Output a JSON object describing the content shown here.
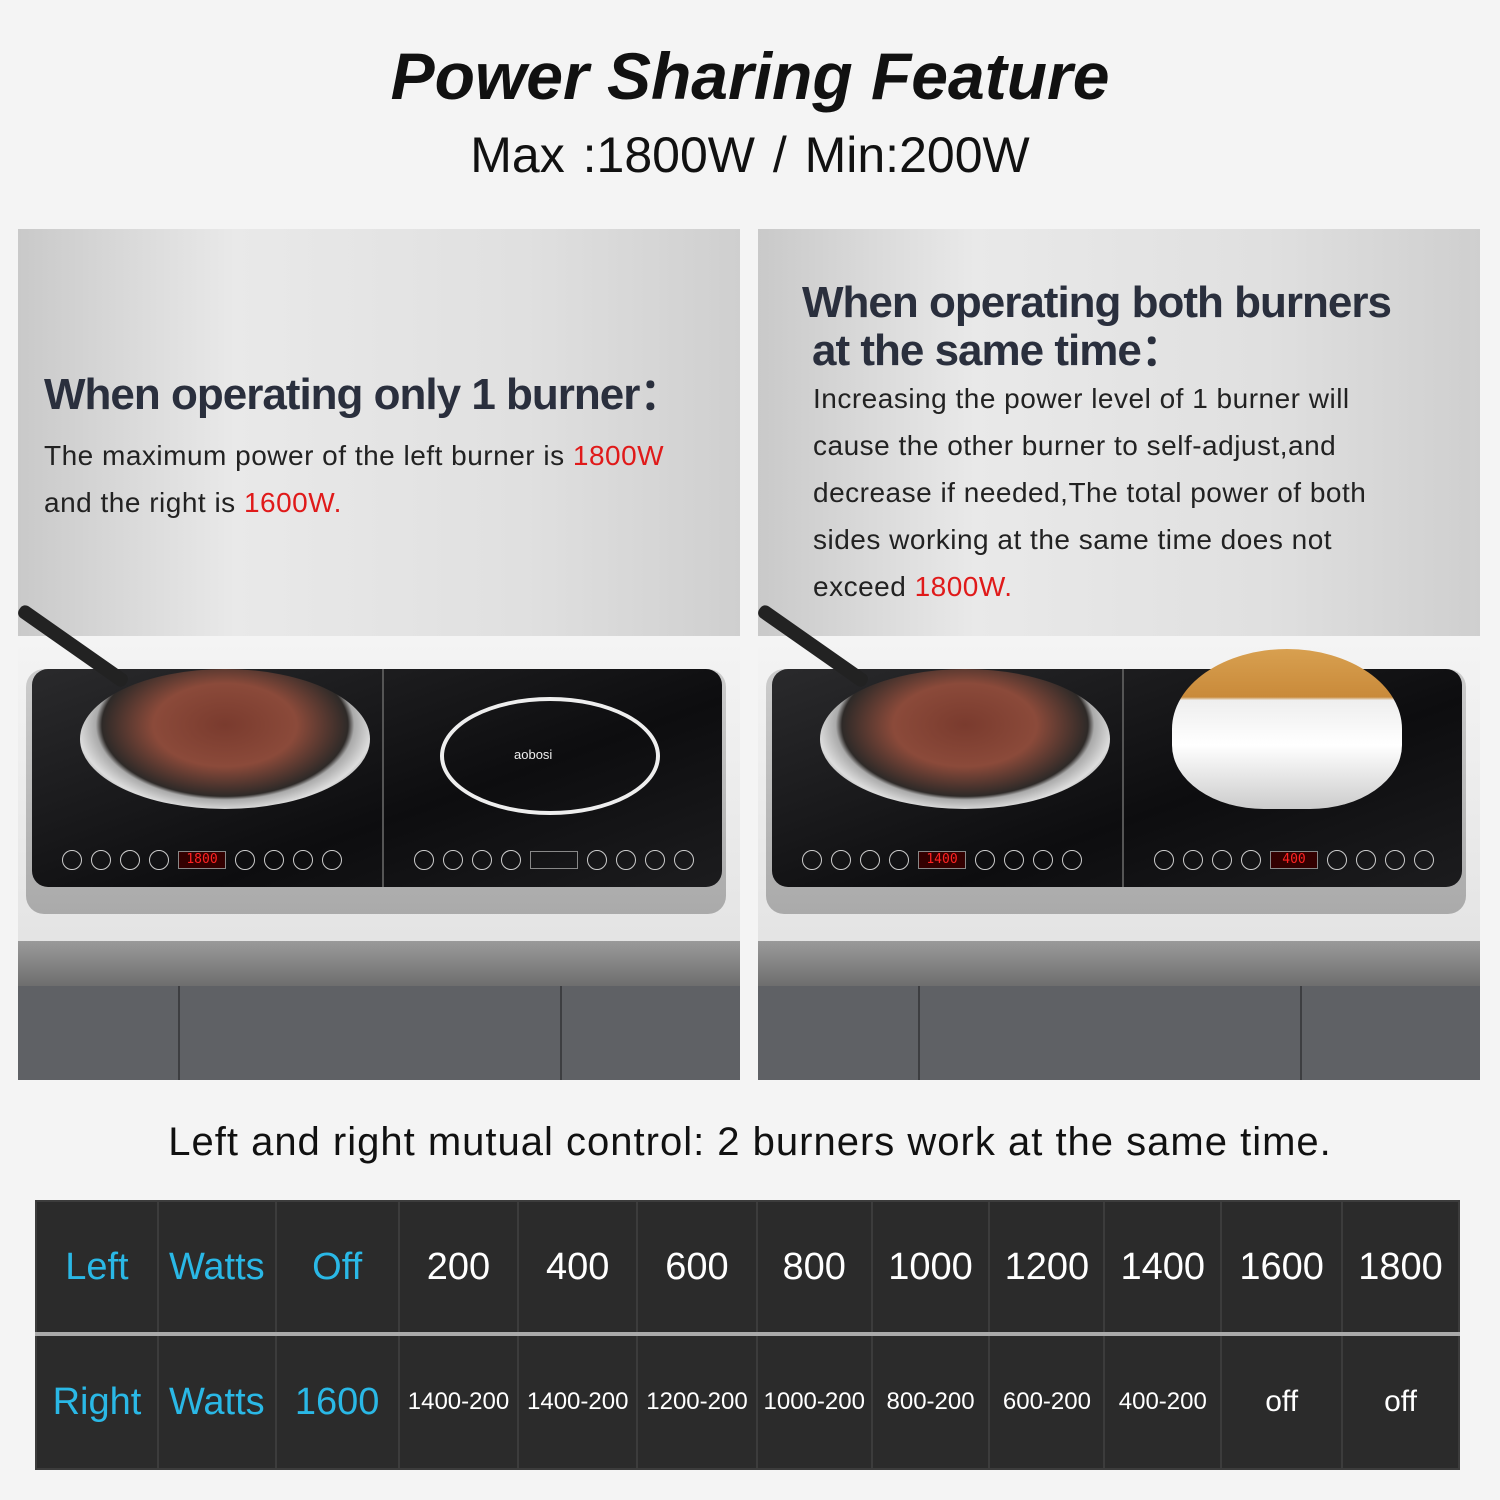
{
  "title": "Power Sharing Feature",
  "subtitle": "Max :1800W   /   Min:200W",
  "left_panel": {
    "heading": "When operating only 1 burner：",
    "text_1": "The maximum power of the left burner is ",
    "highlight_1": "1800W",
    "text_2": "and the right is ",
    "highlight_2": "1600W.",
    "brand_logo": "aobosi",
    "left_display": "1800",
    "right_display": ""
  },
  "right_panel": {
    "heading_line1": "When operating both burners",
    "heading_line2": "at the same time：",
    "lines": [
      "Increasing the power level of 1 burner will",
      "cause the other burner to self-adjust,and",
      "decrease if needed,The total power of both",
      "sides working at the same time does not"
    ],
    "last_line_text": "exceed ",
    "highlight": "1800W.",
    "left_display": "1400",
    "right_display": "400"
  },
  "caption": "Left and right mutual control: 2 burners work at the same time.",
  "colors": {
    "accent_blue": "#2ab8e6",
    "highlight_red": "#e01a1a",
    "table_bg": "#2b2b2b"
  },
  "table": {
    "row1": [
      "Left",
      "Watts",
      "Off",
      "200",
      "400",
      "600",
      "800",
      "1000",
      "1200",
      "1400",
      "1600",
      "1800"
    ],
    "row2": [
      "Right",
      "Watts",
      "1600",
      "1400-200",
      "1400-200",
      "1200-200",
      "1000-200",
      "800-200",
      "600-200",
      "400-200",
      "off",
      "off"
    ]
  }
}
